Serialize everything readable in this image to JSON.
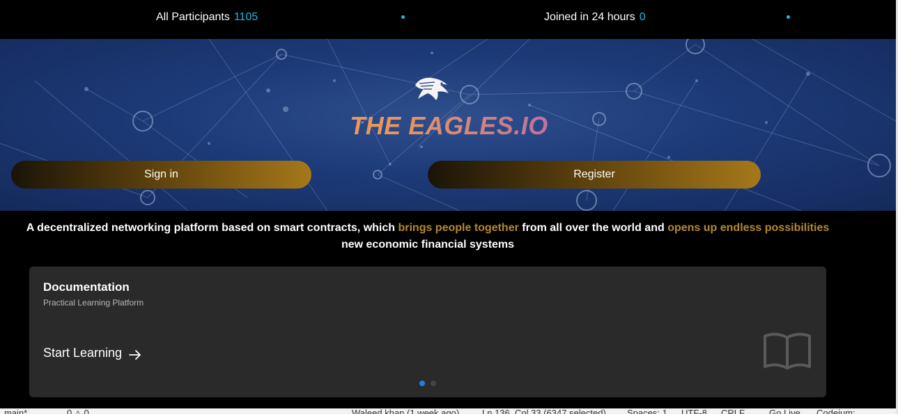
{
  "stats": {
    "participants_label": "All Participants",
    "participants_value": "1105",
    "joined_label": "Joined in 24 hours",
    "joined_value": "0"
  },
  "hero": {
    "brand": "THE EAGLES.IO",
    "sign_in": "Sign in",
    "register": "Register"
  },
  "tagline": {
    "part1": "A decentralized networking platform based on smart contracts, which ",
    "highlight1": "brings people together",
    "part2": " from all over the world and ",
    "highlight2": "opens up endless possibilities",
    "line2": "new economic financial systems"
  },
  "card": {
    "title": "Documentation",
    "subtitle": "Practical Learning Platform",
    "cta": "Start Learning",
    "carousel_count": 2,
    "carousel_active": 1
  },
  "statusbar": {
    "branch": "main*",
    "problems": "0 △ 0",
    "blame": "Waleed khan (1 week ago)",
    "position": "Ln 136, Col 33 (6347 selected)",
    "spaces": "Spaces: 1",
    "encoding": "UTF-8",
    "eol": "CRLF",
    "golive": "Go Live",
    "codeium": "Codeium:"
  },
  "colors": {
    "accent_cyan": "#22b8e6",
    "gold_highlight": "#b58830",
    "carousel_active": "#1f7fe8",
    "card_bg": "#2a2a2a"
  },
  "icons": {
    "logo": "eagle-logo-icon",
    "arrow": "arrow-right-icon",
    "book": "open-book-icon"
  }
}
